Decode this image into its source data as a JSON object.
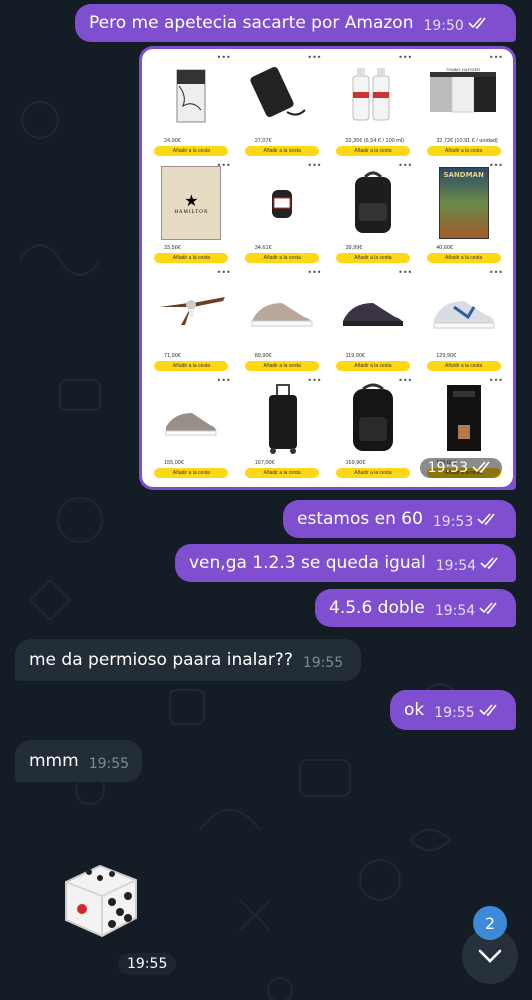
{
  "messages": [
    {
      "text": "Pero me apetecia sacarte por Amazon",
      "time": "19:50"
    },
    {
      "text": "estamos en 60",
      "time": "19:53"
    },
    {
      "text": "ven,ga 1.2.3 se queda igual",
      "time": "19:54"
    },
    {
      "text": "4.5.6 doble",
      "time": "19:54"
    },
    {
      "text": "me da permioso paara inalar??",
      "time": "19:55"
    },
    {
      "text": "ok",
      "time": "19:55"
    },
    {
      "text": "mmm",
      "time": "19:55"
    }
  ],
  "photo": {
    "time": "19:53",
    "products": [
      {
        "price": "24,90€",
        "button": "Añadir a la cesta"
      },
      {
        "price": "27,07€",
        "button": "Añadir a la cesta"
      },
      {
        "price": "32,35€ (6,54 € / 100 ml)",
        "button": "Añadir a la cesta"
      },
      {
        "price": "32,72€ (10,91 € / unidad)",
        "button": "Añadir a la cesta"
      },
      {
        "price": "33,56€",
        "button": "Añadir a la cesta"
      },
      {
        "price": "34,61€",
        "button": "Añadir a la cesta"
      },
      {
        "price": "39,99€",
        "button": "Añadir a la cesta"
      },
      {
        "price": "40,60€",
        "button": "Añadir a la cesta"
      },
      {
        "price": "71,90€",
        "button": "Añadir a la cesta"
      },
      {
        "price": "89,90€",
        "button": "Añadir a la cesta"
      },
      {
        "price": "119,90€",
        "button": "Añadir a la cesta"
      },
      {
        "price": "129,90€",
        "button": "Añadir a la cesta"
      },
      {
        "price": "155,00€",
        "button": "Añadir a la cesta"
      },
      {
        "price": "167,00€",
        "button": "Añadir a la cesta"
      },
      {
        "price": "169,90€",
        "button": "Añadir a la cesta"
      },
      {
        "price": "179,00€",
        "button": "Añadir a la cesta"
      }
    ],
    "book_title": "HAMILTON",
    "comic_title": "SANDMAN",
    "boxers_brand": "TOMMY HILFIGER"
  },
  "dice": {
    "time": "19:55",
    "value": 5
  },
  "scroll": {
    "unread_count": "2"
  },
  "colors": {
    "background": "#141d26",
    "outgoing": "#7f4fd0",
    "incoming": "#222d38",
    "badge": "#3c8ad8"
  }
}
